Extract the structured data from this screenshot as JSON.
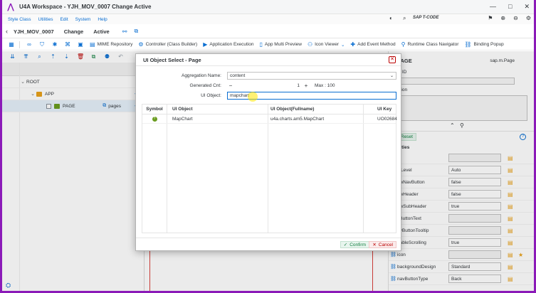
{
  "window": {
    "title": "U4A Workspace - YJH_MOV_0007 Change Active",
    "controls": [
      "—",
      "□",
      "✕"
    ]
  },
  "menu": {
    "items": [
      "Style Class",
      "Utilities",
      "Edit",
      "System",
      "Help"
    ],
    "tcode_label": "SAP T-CODE"
  },
  "header": {
    "app_name": "YJH_MOV_0007",
    "mode": "Change",
    "state": "Active"
  },
  "toolbar": {
    "mime_repository": "MIME Repository",
    "controller": "Controller (Class Builder)",
    "app_execution": "Application Execution",
    "app_multi_preview": "App Multi Preview",
    "icon_viewer": "Icon Viewer",
    "add_event_method": "Add Event Method",
    "runtime_class_navigator": "Runtime Class Navigator",
    "binding_popup": "Binding Popup"
  },
  "tree": {
    "rows": [
      {
        "label": "ROOT"
      },
      {
        "label": "APP"
      },
      {
        "label": "PAGE",
        "aggregation": "pages"
      }
    ]
  },
  "right_panel": {
    "title": "PAGE",
    "subtitle": "sap.m.Page",
    "object_id_label": "ct ID",
    "description_label": "ation",
    "reset_label": "Reset",
    "properties_title": "erties",
    "properties": [
      {
        "name": "le",
        "value": ""
      },
      {
        "name": "leLevel",
        "value": "Auto"
      },
      {
        "name": "owNavButton",
        "value": "false"
      },
      {
        "name": "owHeader",
        "value": "false"
      },
      {
        "name": "owSubHeader",
        "value": "true"
      },
      {
        "name": "vButtonText",
        "value": ""
      },
      {
        "name": "avButtonTooltip",
        "value": ""
      },
      {
        "name": "nableScrolling",
        "value": "true"
      },
      {
        "name": "icon",
        "value": ""
      },
      {
        "name": "backgroundDesign",
        "value": "Standard"
      },
      {
        "name": "navButtonType",
        "value": "Back"
      }
    ]
  },
  "dialog": {
    "title": "UI Object Select - Page",
    "aggregation_label": "Aggregation Name:",
    "aggregation_value": "content",
    "generated_label": "Generated Cnt:",
    "generated_value": "1",
    "max_text": "Max : 100",
    "uiobject_label": "UI Object:",
    "uiobject_value": "mapchart",
    "table": {
      "headers": [
        "Symbol",
        "UI Object",
        "UI Object(Fullname)",
        "UI Key"
      ],
      "rows": [
        {
          "symbol": "?",
          "object": "MapChart",
          "fullname": "u4a.charts.am5.MapChart",
          "key": "UO02684"
        }
      ]
    },
    "confirm_label": "Confirm",
    "cancel_label": "Cancel"
  }
}
